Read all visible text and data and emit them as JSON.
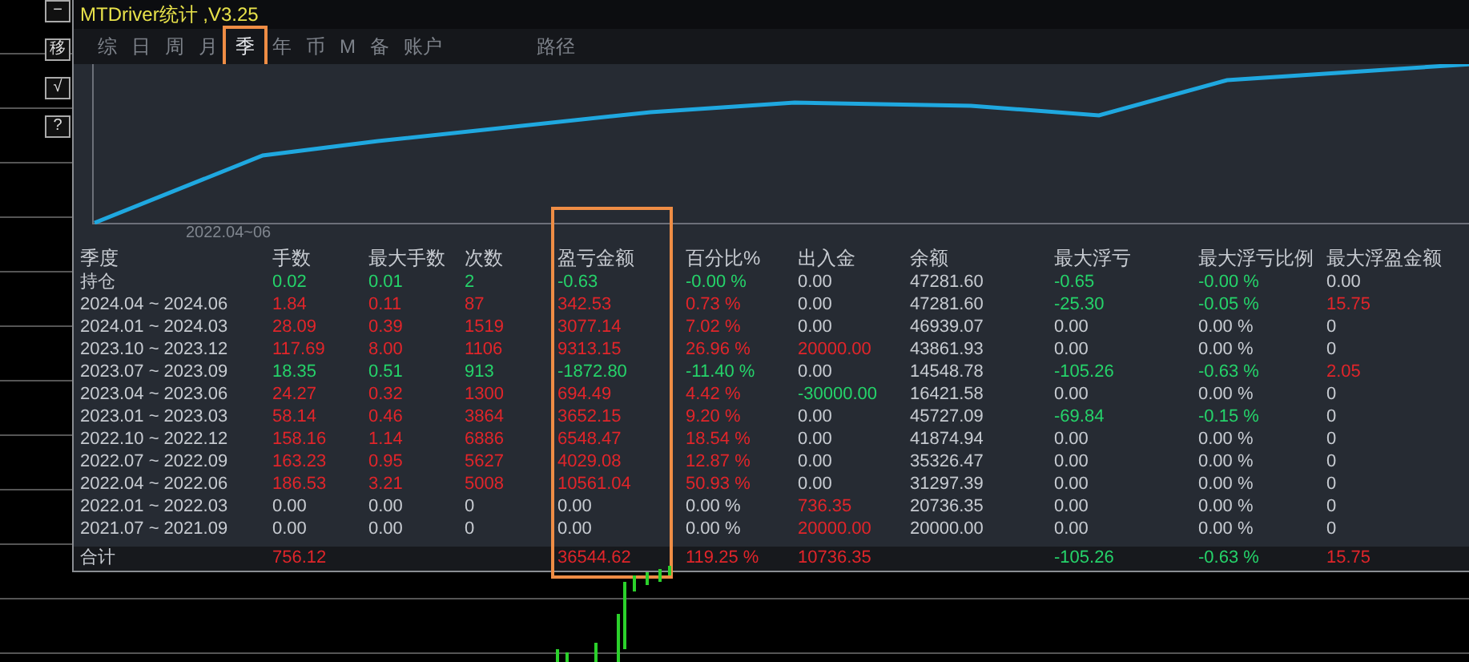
{
  "side_buttons": [
    "−",
    "移",
    "√",
    "?"
  ],
  "window": {
    "title": "MTDriver统计 ,V3.25"
  },
  "tabs": [
    {
      "label": "综",
      "selected": false,
      "highlighted": false
    },
    {
      "label": "日",
      "selected": false,
      "highlighted": false
    },
    {
      "label": "周",
      "selected": false,
      "highlighted": false
    },
    {
      "label": "月",
      "selected": false,
      "highlighted": false
    },
    {
      "label": "季",
      "selected": true,
      "highlighted": true
    },
    {
      "label": "年",
      "selected": false,
      "highlighted": false
    },
    {
      "label": "币",
      "selected": false,
      "highlighted": false
    },
    {
      "label": "M",
      "selected": false,
      "highlighted": false
    },
    {
      "label": "备",
      "selected": false,
      "highlighted": false
    },
    {
      "label": "账户",
      "selected": false,
      "highlighted": false
    }
  ],
  "path_tab": {
    "label": "路径"
  },
  "chart": {
    "x_label": "2022.04~06"
  },
  "table": {
    "columns": [
      {
        "label": "季度",
        "highlighted": false
      },
      {
        "label": "手数",
        "highlighted": false
      },
      {
        "label": "最大手数",
        "highlighted": false
      },
      {
        "label": "次数",
        "highlighted": false
      },
      {
        "label": "盈亏金额",
        "highlighted": true
      },
      {
        "label": "百分比%",
        "highlighted": false
      },
      {
        "label": "出入金",
        "highlighted": false
      },
      {
        "label": "余额",
        "highlighted": false
      },
      {
        "label": "最大浮亏",
        "highlighted": false
      },
      {
        "label": "最大浮亏比例",
        "highlighted": false
      },
      {
        "label": "最大浮盈金额",
        "highlighted": false
      }
    ],
    "rows": [
      {
        "total": false,
        "cells": [
          {
            "text": "持仓",
            "kind": "flat"
          },
          {
            "text": "0.02",
            "kind": "loss"
          },
          {
            "text": "0.01",
            "kind": "loss"
          },
          {
            "text": "2",
            "kind": "loss"
          },
          {
            "text": "-0.63",
            "kind": "loss"
          },
          {
            "text": "-0.00 %",
            "kind": "loss"
          },
          {
            "text": "0.00",
            "kind": "flat"
          },
          {
            "text": "47281.60",
            "kind": "flat"
          },
          {
            "text": "-0.65",
            "kind": "loss"
          },
          {
            "text": "-0.00 %",
            "kind": "loss"
          },
          {
            "text": "0.00",
            "kind": "flat"
          }
        ]
      },
      {
        "total": false,
        "cells": [
          {
            "text": "2024.04 ~ 2024.06",
            "kind": "flat"
          },
          {
            "text": "1.84",
            "kind": "profit"
          },
          {
            "text": "0.11",
            "kind": "profit"
          },
          {
            "text": "87",
            "kind": "profit"
          },
          {
            "text": "342.53",
            "kind": "profit"
          },
          {
            "text": "0.73 %",
            "kind": "profit"
          },
          {
            "text": "0.00",
            "kind": "flat"
          },
          {
            "text": "47281.60",
            "kind": "flat"
          },
          {
            "text": "-25.30",
            "kind": "loss"
          },
          {
            "text": "-0.05 %",
            "kind": "loss"
          },
          {
            "text": "15.75",
            "kind": "profit"
          }
        ]
      },
      {
        "total": false,
        "cells": [
          {
            "text": "2024.01 ~ 2024.03",
            "kind": "flat"
          },
          {
            "text": "28.09",
            "kind": "profit"
          },
          {
            "text": "0.39",
            "kind": "profit"
          },
          {
            "text": "1519",
            "kind": "profit"
          },
          {
            "text": "3077.14",
            "kind": "profit"
          },
          {
            "text": "7.02 %",
            "kind": "profit"
          },
          {
            "text": "0.00",
            "kind": "flat"
          },
          {
            "text": "46939.07",
            "kind": "flat"
          },
          {
            "text": "0.00",
            "kind": "flat"
          },
          {
            "text": "0.00 %",
            "kind": "flat"
          },
          {
            "text": "0",
            "kind": "flat"
          }
        ]
      },
      {
        "total": false,
        "cells": [
          {
            "text": "2023.10 ~ 2023.12",
            "kind": "flat"
          },
          {
            "text": "117.69",
            "kind": "profit"
          },
          {
            "text": "8.00",
            "kind": "profit"
          },
          {
            "text": "1106",
            "kind": "profit"
          },
          {
            "text": "9313.15",
            "kind": "profit"
          },
          {
            "text": "26.96 %",
            "kind": "profit"
          },
          {
            "text": "20000.00",
            "kind": "profit"
          },
          {
            "text": "43861.93",
            "kind": "flat"
          },
          {
            "text": "0.00",
            "kind": "flat"
          },
          {
            "text": "0.00 %",
            "kind": "flat"
          },
          {
            "text": "0",
            "kind": "flat"
          }
        ]
      },
      {
        "total": false,
        "cells": [
          {
            "text": "2023.07 ~ 2023.09",
            "kind": "flat"
          },
          {
            "text": "18.35",
            "kind": "loss"
          },
          {
            "text": "0.51",
            "kind": "loss"
          },
          {
            "text": "913",
            "kind": "loss"
          },
          {
            "text": "-1872.80",
            "kind": "loss"
          },
          {
            "text": "-11.40 %",
            "kind": "loss"
          },
          {
            "text": "0.00",
            "kind": "flat"
          },
          {
            "text": "14548.78",
            "kind": "flat"
          },
          {
            "text": "-105.26",
            "kind": "loss"
          },
          {
            "text": "-0.63 %",
            "kind": "loss"
          },
          {
            "text": "2.05",
            "kind": "profit"
          }
        ]
      },
      {
        "total": false,
        "cells": [
          {
            "text": "2023.04 ~ 2023.06",
            "kind": "flat"
          },
          {
            "text": "24.27",
            "kind": "profit"
          },
          {
            "text": "0.32",
            "kind": "profit"
          },
          {
            "text": "1300",
            "kind": "profit"
          },
          {
            "text": "694.49",
            "kind": "profit"
          },
          {
            "text": "4.42 %",
            "kind": "profit"
          },
          {
            "text": "-30000.00",
            "kind": "loss"
          },
          {
            "text": "16421.58",
            "kind": "flat"
          },
          {
            "text": "0.00",
            "kind": "flat"
          },
          {
            "text": "0.00 %",
            "kind": "flat"
          },
          {
            "text": "0",
            "kind": "flat"
          }
        ]
      },
      {
        "total": false,
        "cells": [
          {
            "text": "2023.01 ~ 2023.03",
            "kind": "flat"
          },
          {
            "text": "58.14",
            "kind": "profit"
          },
          {
            "text": "0.46",
            "kind": "profit"
          },
          {
            "text": "3864",
            "kind": "profit"
          },
          {
            "text": "3652.15",
            "kind": "profit"
          },
          {
            "text": "9.20 %",
            "kind": "profit"
          },
          {
            "text": "0.00",
            "kind": "flat"
          },
          {
            "text": "45727.09",
            "kind": "flat"
          },
          {
            "text": "-69.84",
            "kind": "loss"
          },
          {
            "text": "-0.15 %",
            "kind": "loss"
          },
          {
            "text": "0",
            "kind": "flat"
          }
        ]
      },
      {
        "total": false,
        "cells": [
          {
            "text": "2022.10 ~ 2022.12",
            "kind": "flat"
          },
          {
            "text": "158.16",
            "kind": "profit"
          },
          {
            "text": "1.14",
            "kind": "profit"
          },
          {
            "text": "6886",
            "kind": "profit"
          },
          {
            "text": "6548.47",
            "kind": "profit"
          },
          {
            "text": "18.54 %",
            "kind": "profit"
          },
          {
            "text": "0.00",
            "kind": "flat"
          },
          {
            "text": "41874.94",
            "kind": "flat"
          },
          {
            "text": "0.00",
            "kind": "flat"
          },
          {
            "text": "0.00 %",
            "kind": "flat"
          },
          {
            "text": "0",
            "kind": "flat"
          }
        ]
      },
      {
        "total": false,
        "cells": [
          {
            "text": "2022.07 ~ 2022.09",
            "kind": "flat"
          },
          {
            "text": "163.23",
            "kind": "profit"
          },
          {
            "text": "0.95",
            "kind": "profit"
          },
          {
            "text": "5627",
            "kind": "profit"
          },
          {
            "text": "4029.08",
            "kind": "profit"
          },
          {
            "text": "12.87 %",
            "kind": "profit"
          },
          {
            "text": "0.00",
            "kind": "flat"
          },
          {
            "text": "35326.47",
            "kind": "flat"
          },
          {
            "text": "0.00",
            "kind": "flat"
          },
          {
            "text": "0.00 %",
            "kind": "flat"
          },
          {
            "text": "0",
            "kind": "flat"
          }
        ]
      },
      {
        "total": false,
        "cells": [
          {
            "text": "2022.04 ~ 2022.06",
            "kind": "flat"
          },
          {
            "text": "186.53",
            "kind": "profit"
          },
          {
            "text": "3.21",
            "kind": "profit"
          },
          {
            "text": "5008",
            "kind": "profit"
          },
          {
            "text": "10561.04",
            "kind": "profit"
          },
          {
            "text": "50.93 %",
            "kind": "profit"
          },
          {
            "text": "0.00",
            "kind": "flat"
          },
          {
            "text": "31297.39",
            "kind": "flat"
          },
          {
            "text": "0.00",
            "kind": "flat"
          },
          {
            "text": "0.00 %",
            "kind": "flat"
          },
          {
            "text": "0",
            "kind": "flat"
          }
        ]
      },
      {
        "total": false,
        "cells": [
          {
            "text": "2022.01 ~ 2022.03",
            "kind": "flat"
          },
          {
            "text": "0.00",
            "kind": "flat"
          },
          {
            "text": "0.00",
            "kind": "flat"
          },
          {
            "text": "0",
            "kind": "flat"
          },
          {
            "text": "0.00",
            "kind": "flat"
          },
          {
            "text": "0.00 %",
            "kind": "flat"
          },
          {
            "text": "736.35",
            "kind": "profit"
          },
          {
            "text": "20736.35",
            "kind": "flat"
          },
          {
            "text": "0.00",
            "kind": "flat"
          },
          {
            "text": "0.00 %",
            "kind": "flat"
          },
          {
            "text": "0",
            "kind": "flat"
          }
        ]
      },
      {
        "total": false,
        "cells": [
          {
            "text": "2021.07 ~ 2021.09",
            "kind": "flat"
          },
          {
            "text": "0.00",
            "kind": "flat"
          },
          {
            "text": "0.00",
            "kind": "flat"
          },
          {
            "text": "0",
            "kind": "flat"
          },
          {
            "text": "0.00",
            "kind": "flat"
          },
          {
            "text": "0.00 %",
            "kind": "flat"
          },
          {
            "text": "20000.00",
            "kind": "profit"
          },
          {
            "text": "20000.00",
            "kind": "flat"
          },
          {
            "text": "0.00",
            "kind": "flat"
          },
          {
            "text": "0.00 %",
            "kind": "flat"
          },
          {
            "text": "0",
            "kind": "flat"
          }
        ]
      },
      {
        "total": true,
        "cells": [
          {
            "text": "合计",
            "kind": "flat"
          },
          {
            "text": "756.12",
            "kind": "profit"
          },
          null,
          null,
          {
            "text": "36544.62",
            "kind": "profit"
          },
          {
            "text": "119.25 %",
            "kind": "profit"
          },
          {
            "text": "10736.35",
            "kind": "profit"
          },
          null,
          {
            "text": "-105.26",
            "kind": "loss"
          },
          {
            "text": "-0.63 %",
            "kind": "loss"
          },
          {
            "text": "15.75",
            "kind": "profit"
          }
        ]
      }
    ]
  }
}
